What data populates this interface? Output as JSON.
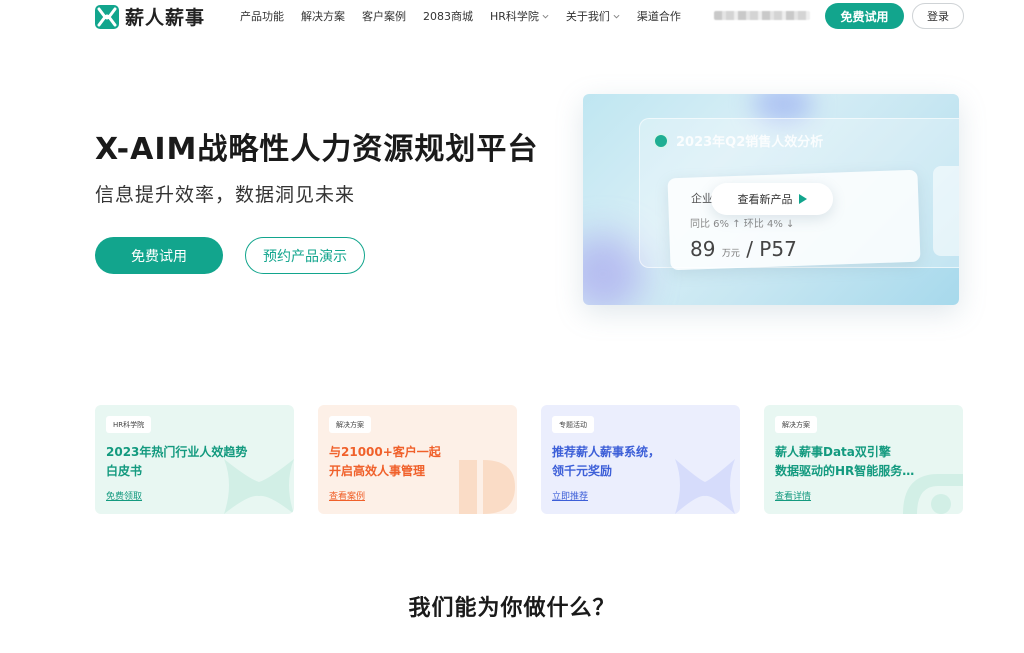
{
  "header": {
    "logo_text": "薪人薪事",
    "nav": [
      {
        "label": "产品功能",
        "has_dropdown": false
      },
      {
        "label": "解决方案",
        "has_dropdown": false
      },
      {
        "label": "客户案例",
        "has_dropdown": false
      },
      {
        "label": "2083商城",
        "has_dropdown": false
      },
      {
        "label": "HR科学院",
        "has_dropdown": true
      },
      {
        "label": "关于我们",
        "has_dropdown": true
      },
      {
        "label": "渠道合作",
        "has_dropdown": false
      }
    ],
    "trial_button": "免费试用",
    "login_button": "登录"
  },
  "hero": {
    "title": "X-AIM战略性人力资源规划平台",
    "subtitle": "信息提升效率，数据洞见未来",
    "trial_button": "免费试用",
    "demo_button": "预约产品演示",
    "visual": {
      "panel_title": "2023年Q2销售人效分析",
      "card_label": "企业",
      "compare_text": "同比 6% ↑   环比 4% ↓",
      "number": "89",
      "unit": "万元",
      "level": "P57",
      "play_label": "查看新产品"
    }
  },
  "cards": [
    {
      "tag": "HR科学院",
      "title_line1": "2023年热门行业人效趋势",
      "title_line2": "白皮书",
      "link": "免费领取"
    },
    {
      "tag": "解决方案",
      "title_line1": "与21000+客户一起",
      "title_line2": "开启高效人事管理",
      "link": "查看案例"
    },
    {
      "tag": "专题活动",
      "title_line1": "推荐薪人薪事系统，",
      "title_line2": "领千元奖励",
      "link": "立即推荐"
    },
    {
      "tag": "解决方案",
      "title_line1": "薪人薪事Data双引擎",
      "title_line2": "数据驱动的HR智能服务…",
      "link": "查看详情"
    }
  ],
  "section": {
    "title": "我们能为你做什么？"
  },
  "colors": {
    "brand": "#12a58d",
    "orange": "#f0602a",
    "blue": "#3d5fd8"
  }
}
